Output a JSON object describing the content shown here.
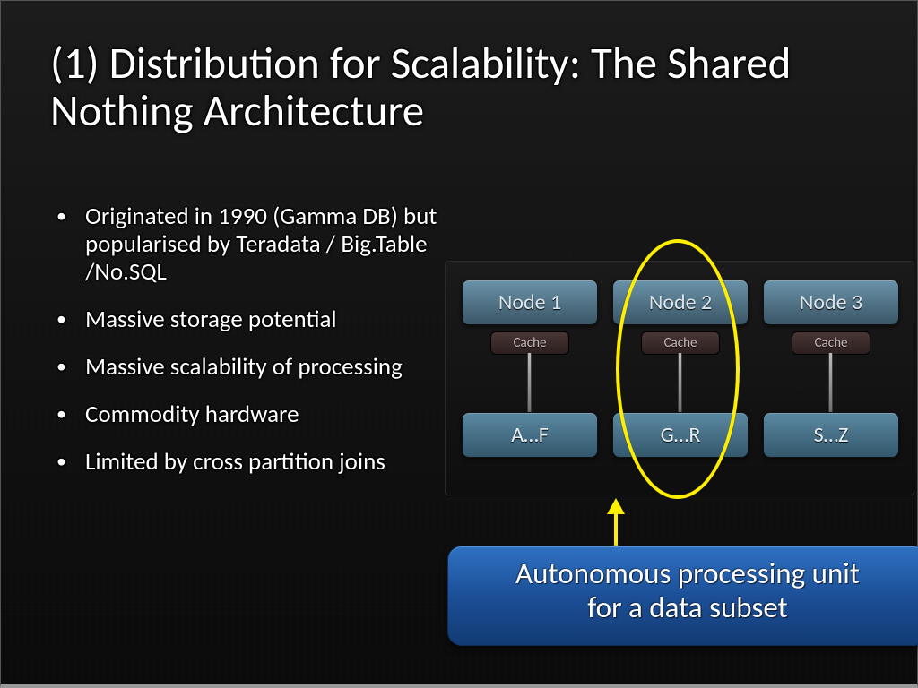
{
  "title": "(1) Distribution for Scalability: The Shared Nothing Architecture",
  "bullets": [
    "Originated in 1990 (Gamma DB) but popularised by Teradata / Big.Table /No.SQL",
    "Massive storage potential",
    "Massive scalability of processing",
    "Commodity hardware",
    "Limited by cross partition joins"
  ],
  "diagram": {
    "nodes": [
      "Node 1",
      "Node 2",
      "Node 3"
    ],
    "cache_label": "Cache",
    "data": [
      "A…F",
      "G…R",
      "S…Z"
    ]
  },
  "callout": {
    "line1": "Autonomous processing unit",
    "line2": "for a data subset"
  }
}
